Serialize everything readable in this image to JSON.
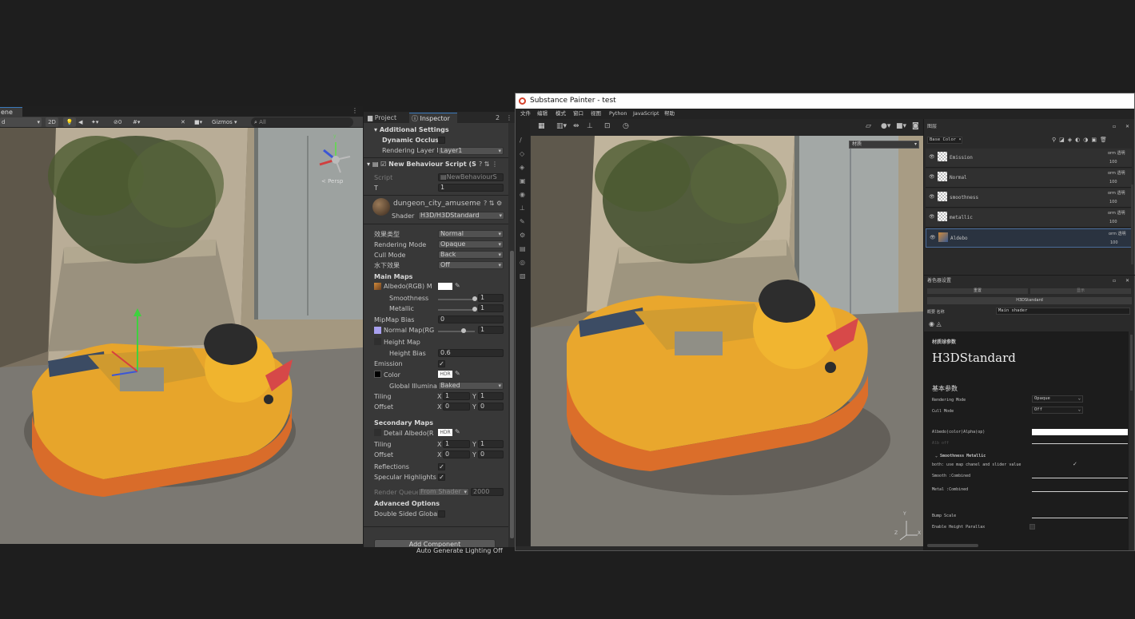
{
  "unity_scene": {
    "tab_label": "ene",
    "toolbar": {
      "shading_mode": "d",
      "mode_2d": "2D",
      "hidden_count": "0",
      "gizmos_label": "Gizmos",
      "search_placeholder": "All"
    },
    "persp_label": "< Persp",
    "gizmo_axis_y": "y"
  },
  "inspector": {
    "tabs": [
      {
        "label": "Project",
        "icon": "folder-icon"
      },
      {
        "label": "Inspector",
        "icon": "info-icon"
      }
    ],
    "lock_count": "2",
    "additional_settings_header": "Additional Settings",
    "dynamic_occlusion_label": "Dynamic Occlusic",
    "rendering_layer_label": "Rendering Layer M",
    "rendering_layer_value": "Layer1",
    "script_component_title": "New Behaviour Script (S",
    "script_label": "Script",
    "script_value": "NewBehaviourS",
    "t_label": "T",
    "t_value": "1",
    "material_name": "dungeon_city_amusemen",
    "shader_label": "Shader",
    "shader_value": "H3D/H3DStandard",
    "effect_type_label": "效果类型",
    "effect_type_value": "Normal",
    "rendering_mode_label": "Rendering Mode",
    "rendering_mode_value": "Opaque",
    "cull_mode_label": "Cull Mode",
    "cull_mode_value": "Back",
    "underwater_label": "水下效果",
    "underwater_value": "Off",
    "main_maps_header": "Main Maps",
    "albedo_label": "Albedo(RGB) M",
    "smoothness_label": "Smoothness",
    "smoothness_value": "1",
    "smoothness_fraction": 1.0,
    "metallic_label": "Metallic",
    "metallic_value": "1",
    "metallic_fraction": 1.0,
    "mipmap_bias_label": "MipMap Bias",
    "mipmap_bias_value": "0",
    "normal_map_label": "Normal Map(RG",
    "normal_map_value": "1",
    "normal_map_fraction": 0.7,
    "height_map_label": "Height Map",
    "height_bias_label": "Height Bias",
    "height_bias_value": "0.6",
    "emission_label": "Emission",
    "color_label": "Color",
    "hdr_badge": "HDR",
    "global_illum_label": "Global Illuminat",
    "global_illum_value": "Baked",
    "tiling_label": "Tiling",
    "offset_label": "Offset",
    "x_label": "X",
    "y_label": "Y",
    "tiling_x": "1",
    "tiling_y": "1",
    "offset_x": "0",
    "offset_y": "0",
    "secondary_maps_header": "Secondary Maps",
    "detail_albedo_label": "Detail Albedo(R",
    "tiling2_x": "1",
    "tiling2_y": "1",
    "offset2_x": "0",
    "offset2_y": "0",
    "reflections_label": "Reflections",
    "specular_label": "Specular Highlights",
    "render_queue_label": "Render Queue",
    "render_queue_mode": "From Shader",
    "render_queue_value": "2000",
    "advanced_header": "Advanced Options",
    "double_sided_label": "Double Sided Global",
    "add_component_label": "Add Component",
    "auto_generate_label": "Auto Generate Lighting Off"
  },
  "substance": {
    "title": "Substance Painter - test",
    "menu": [
      "文件",
      "编辑",
      "模式",
      "窗口",
      "视图",
      "Python",
      "JavaScript",
      "帮助"
    ],
    "viewport_dropdown": "材质",
    "axis_z": "Z",
    "axis_x": "X",
    "axis_y": "Y",
    "layers_panel_title": "图层",
    "channel_dropdown": "Base Color",
    "layers": [
      {
        "name": "Emission",
        "blend": "orm 透明",
        "opacity": "100"
      },
      {
        "name": "Normal",
        "blend": "orm 透明",
        "opacity": "100"
      },
      {
        "name": "smoothness",
        "blend": "orm 透明",
        "opacity": "100"
      },
      {
        "name": "metallic",
        "blend": "orm 透明",
        "opacity": "100"
      },
      {
        "name": "Aldebo",
        "blend": "orm 透明",
        "opacity": "100"
      }
    ],
    "shader_panel_title": "着色器设置",
    "btn_left": "重置",
    "btn_right": "显示",
    "shader_name_bar": "H3DStandard",
    "name_label": "概要 名称",
    "name_value": "Main shader",
    "material_params_label": "材质球参数",
    "shader_big_title": "H3DStandard",
    "basic_params_label": "基本参数",
    "rendering_mode_label": "Rendering Mode",
    "rendering_mode_value": "Opaque",
    "cull_mode_label": "Cull Mode",
    "cull_mode_value": "Off",
    "albedo_label": "Albedo(color)Alpha(op)",
    "faded_label": "Alb off",
    "sm_group_label": "Smoothness Metallic",
    "both_label": "both: use map chanel and slider value",
    "smooth_label": "Smooth :Combined",
    "metal_label": "Metal :Combined",
    "bump_label": "Bump Scale",
    "parallax_label": "Enable Height Parallax"
  }
}
